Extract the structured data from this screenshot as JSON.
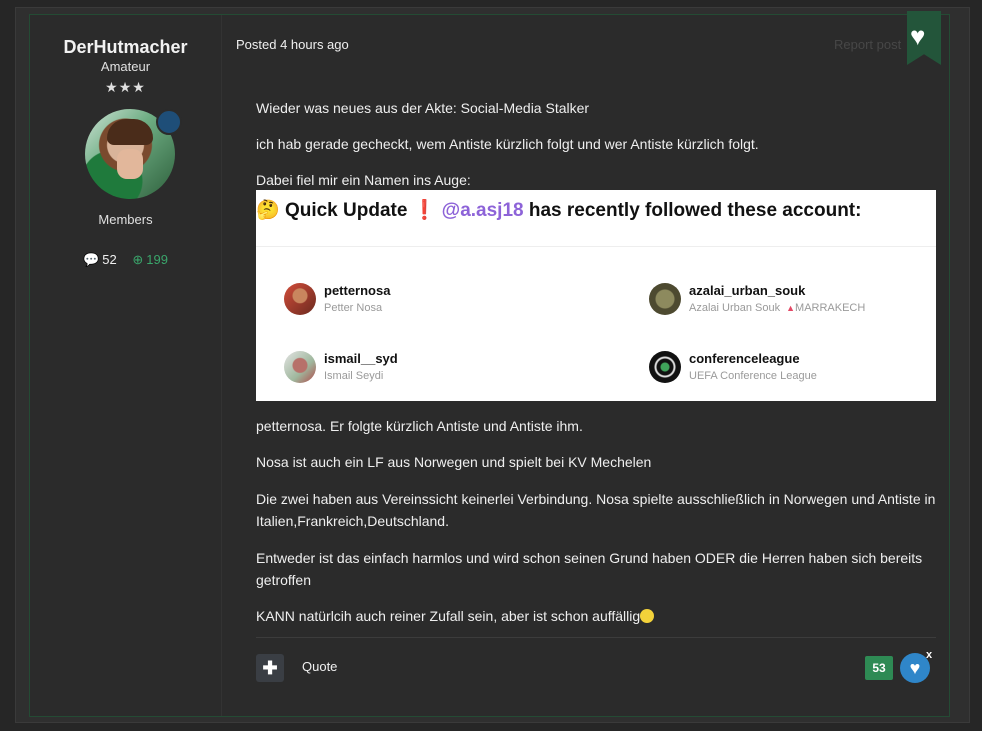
{
  "author": {
    "name": "DerHutmacher",
    "rank": "Amateur",
    "stars": "★★★",
    "group": "Members",
    "posts_count": "52",
    "reputation": "199"
  },
  "post": {
    "meta": "Posted 4 hours ago",
    "report_label": "Report post",
    "paragraphs": [
      "Wieder was neues aus der Akte: Social-Media Stalker",
      "ich hab gerade gecheckt, wem Antiste kürzlich folgt und wer Antiste kürzlich folgt.",
      "Dabei fiel mir ein Namen ins Auge:",
      "petternosa. Er folgte kürzlich Antiste und Antiste ihm.",
      "Nosa ist auch ein LF aus Norwegen und spielt bei KV Mechelen",
      "Die zwei haben aus Vereinssicht keinerlei Verbindung. Nosa spielte ausschließlich in Norwegen und Antiste in Italien,Frankreich,Deutschland.",
      "Entweder ist das einfach harmlos und wird schon seinen Grund haben ODER die Herren haben sich bereits getroffen",
      "KANN natürlcih auch reiner Zufall sein, aber ist schon auffällig"
    ],
    "embed": {
      "title_emoji": "🤔",
      "title_prefix": "Quick Update",
      "title_excl": "❗",
      "title_handle": "@a.asj18",
      "title_suffix": "has recently followed these account:",
      "accounts": [
        {
          "username": "petternosa",
          "display_name": "Petter Nosa",
          "location": ""
        },
        {
          "username": "azalai_urban_souk",
          "display_name": "Azalai Urban Souk",
          "location": "MARRAKECH"
        },
        {
          "username": "ismail__syd",
          "display_name": "Ismail Seydi",
          "location": ""
        },
        {
          "username": "conferenceleague",
          "display_name": "UEFA Conference League",
          "location": ""
        }
      ]
    },
    "quote_label": "Quote",
    "reaction_count": "53",
    "close_label": "x"
  },
  "colors": {
    "accent_green": "#2e8a54",
    "ribbon_green": "#23553a",
    "handle_purple": "#8d63d8",
    "reaction_blue": "#2f86c9"
  },
  "icons": {
    "favorite": "heart-icon",
    "posts": "speech-bubble-icon",
    "reputation": "plus-circle-icon",
    "multiquote": "plus-icon",
    "reaction": "heart-icon"
  }
}
